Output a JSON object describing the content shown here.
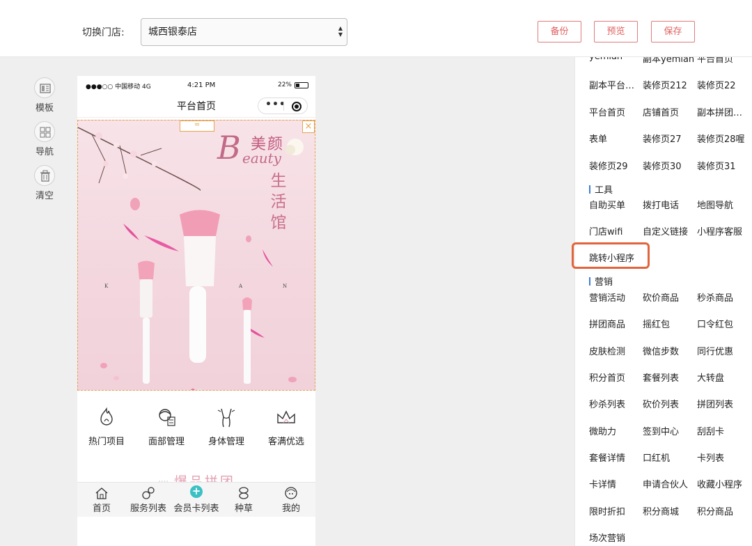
{
  "topbar": {
    "store_label": "切换门店:",
    "store_value": "城西银泰店",
    "buttons": {
      "backup": "备份",
      "preview": "预览",
      "save": "保存"
    }
  },
  "tools": [
    {
      "label": "模板",
      "icon": "template-icon"
    },
    {
      "label": "导航",
      "icon": "grid-nav-icon"
    },
    {
      "label": "清空",
      "icon": "trash-icon"
    }
  ],
  "phone": {
    "status": {
      "carrier": "●●●○○ 中国移动 4G",
      "time": "4:21 PM",
      "battery": "22%"
    },
    "nav_title": "平台首页",
    "capsule_dots": "•••",
    "banner": {
      "logo_letter": "B",
      "logo_cn": "美颜",
      "logo_en": "eauty",
      "vertical_text": [
        "生",
        "活",
        "馆"
      ],
      "brush_letters": [
        "K",
        "A",
        "N"
      ]
    },
    "drag_handle": "═",
    "close": "×",
    "quick_icons": [
      {
        "label": "热门项目",
        "icon": "fire-icon"
      },
      {
        "label": "面部管理",
        "icon": "face-care-icon"
      },
      {
        "label": "身体管理",
        "icon": "body-care-icon"
      },
      {
        "label": "客满优选",
        "icon": "crown-icon"
      }
    ],
    "section_title": "爆品拼团",
    "section_slash": "////",
    "tabs": [
      {
        "label": "首页",
        "icon": "home-icon"
      },
      {
        "label": "服务列表",
        "icon": "service-icon"
      },
      {
        "label": "会员卡列表",
        "icon": "plus-icon",
        "plus": "+"
      },
      {
        "label": "种草",
        "icon": "grass-icon"
      },
      {
        "label": "我的",
        "icon": "profile-icon"
      }
    ]
  },
  "links": {
    "pages_rows": [
      [
        "yemian",
        "副本yemian",
        "平台首页"
      ],
      [
        "副本平台…",
        "装修页212",
        "装修页22"
      ],
      [
        "平台首页",
        "店铺首页",
        "副本拼团…"
      ],
      [
        "表单",
        "装修页27",
        "装修页28喔"
      ],
      [
        "装修页29",
        "装修页30",
        "装修页31"
      ]
    ],
    "tools_title": "工具",
    "tools_rows": [
      [
        "自助买单",
        "拨打电话",
        "地图导航"
      ],
      [
        "门店wifi",
        "自定义链接",
        "小程序客服"
      ],
      [
        "跳转小程序"
      ]
    ],
    "marketing_title": "营销",
    "marketing_rows": [
      [
        "营销活动",
        "砍价商品",
        "秒杀商品"
      ],
      [
        "拼团商品",
        "摇红包",
        "口令红包"
      ],
      [
        "皮肤检测",
        "微信步数",
        "同行优惠"
      ],
      [
        "积分首页",
        "套餐列表",
        "大转盘"
      ],
      [
        "秒杀列表",
        "砍价列表",
        "拼团列表"
      ],
      [
        "微助力",
        "签到中心",
        "刮刮卡"
      ],
      [
        "套餐详情",
        "口红机",
        "卡列表"
      ],
      [
        "卡详情",
        "申请合伙人",
        "收藏小程序"
      ],
      [
        "限时折扣",
        "积分商城",
        "积分商品"
      ],
      [
        "场次营销"
      ]
    ]
  },
  "colors": {
    "accent": "#e06060",
    "highlight": "#e2643c",
    "group_bar": "#3f7cd6",
    "teal": "#3bc0c4"
  }
}
